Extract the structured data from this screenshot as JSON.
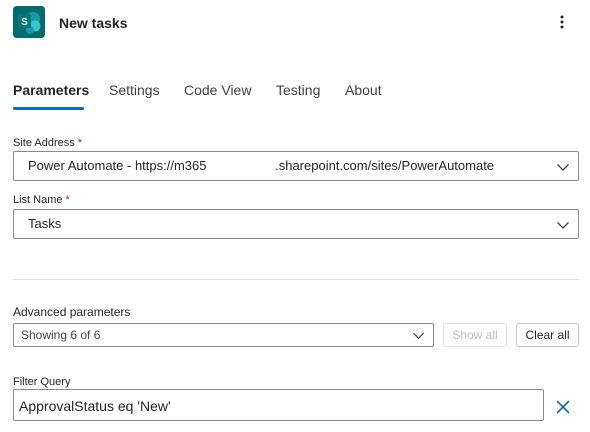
{
  "header": {
    "title": "New tasks",
    "app_icon": "sharepoint-icon",
    "app_icon_letter": "S",
    "more_icon": "more-vertical-icon"
  },
  "tabs": [
    {
      "label": "Parameters",
      "active": true
    },
    {
      "label": "Settings",
      "active": false
    },
    {
      "label": "Code View",
      "active": false
    },
    {
      "label": "Testing",
      "active": false
    },
    {
      "label": "About",
      "active": false
    }
  ],
  "fields": {
    "site_address": {
      "label": "Site Address",
      "required_mark": "*",
      "value": "Power Automate - https://m365                   .sharepoint.com/sites/PowerAutomate"
    },
    "list_name": {
      "label": "List Name",
      "required_mark": "*",
      "value": "Tasks"
    }
  },
  "advanced": {
    "label": "Advanced parameters",
    "selected": "Showing 6 of 6",
    "show_all_label": "Show all",
    "clear_all_label": "Clear all"
  },
  "filter_query": {
    "label": "Filter Query",
    "value": "ApprovalStatus eq 'New'",
    "clear_icon": "close-icon"
  },
  "colors": {
    "accent": "#0f6cbd",
    "sharepoint": "#036c70",
    "required": "#c50f1f"
  }
}
